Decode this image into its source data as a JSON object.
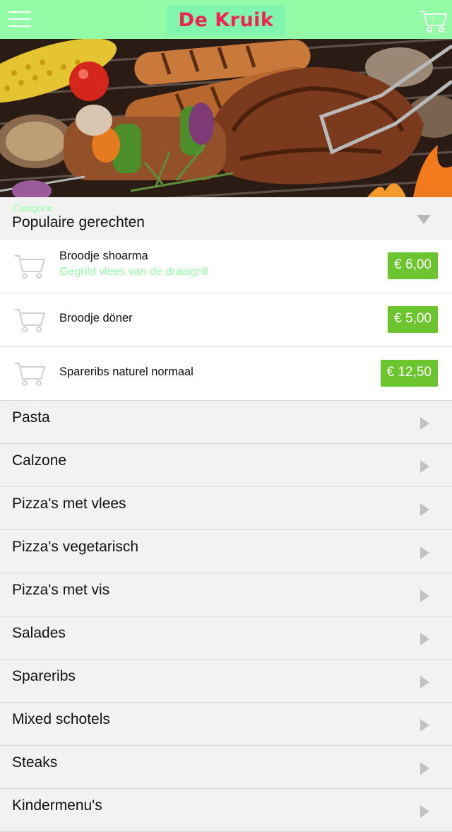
{
  "header": {
    "logo_text": "De Kruik",
    "cart_count": "0",
    "menu_icon": "hamburger-icon",
    "cart_icon": "shopping-cart-icon"
  },
  "colors": {
    "header_bg": "#94fca7",
    "logo_text": "#ee2552",
    "accent_green": "#94fca7",
    "price_bg": "#6cc52f"
  },
  "category": {
    "label": "Categorie",
    "value": "Populaire gerechten"
  },
  "popular_items": [
    {
      "name": "Broodje shoarma",
      "description": "Gegrild vlees van de draaigrill",
      "price": "€ 6,00"
    },
    {
      "name": "Broodje döner",
      "price": "€ 5,00"
    },
    {
      "name": "Spareribs naturel normaal",
      "price": "€ 12,50"
    }
  ],
  "categories": [
    "Pasta",
    "Calzone",
    "Pizza's met vlees",
    "Pizza's vegetarisch",
    "Pizza's met vis",
    "Salades",
    "Spareribs",
    "Mixed schotels",
    "Steaks",
    "Kindermenu's"
  ]
}
